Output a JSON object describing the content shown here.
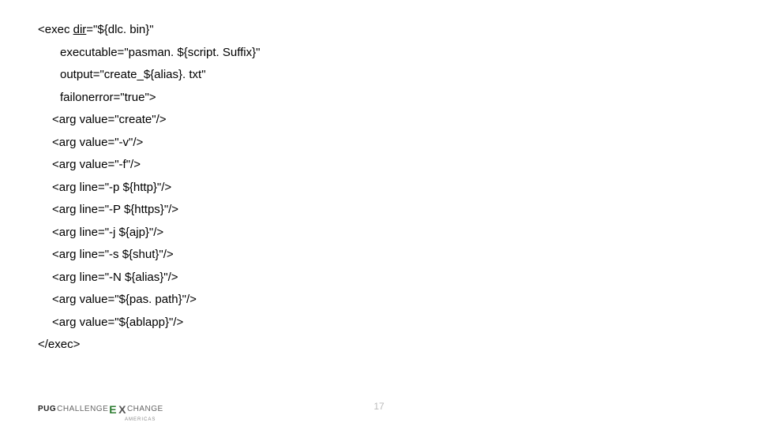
{
  "code": {
    "lines": [
      {
        "indent": "l0",
        "html": "<exec <span class=\"underline\">dir</span>=\"${dlc. bin}\""
      },
      {
        "indent": "l1",
        "text": "executable=\"pasman. ${script. Suffix}\""
      },
      {
        "indent": "l1",
        "text": "output=\"create_${alias}. txt\""
      },
      {
        "indent": "l1",
        "text": "failonerror=\"true\">"
      },
      {
        "indent": "l2",
        "text": "<arg value=\"create\"/>"
      },
      {
        "indent": "l2",
        "text": "<arg value=\"-v\"/>"
      },
      {
        "indent": "l2",
        "text": "<arg value=\"-f\"/>"
      },
      {
        "indent": "l2",
        "text": "<arg line=\"-p ${http}\"/>"
      },
      {
        "indent": "l2",
        "text": "<arg line=\"-P ${https}\"/>"
      },
      {
        "indent": "l2",
        "text": "<arg line=\"-j ${ajp}\"/>"
      },
      {
        "indent": "l2",
        "text": "<arg line=\"-s ${shut}\"/>"
      },
      {
        "indent": "l2",
        "text": "<arg line=\"-N ${alias}\"/>"
      },
      {
        "indent": "l2",
        "text": "<arg value=\"${pas. path}\"/>"
      },
      {
        "indent": "l2",
        "text": "<arg value=\"${ablapp}\"/>"
      },
      {
        "indent": "l0",
        "text": "</exec>"
      }
    ]
  },
  "footer": {
    "logo_pug": "PUG",
    "logo_chal": "CHALLENGE",
    "logo_e": "E",
    "logo_x": "X",
    "logo_change": "CHANGE",
    "logo_sub": "AMERICAS",
    "page": "17"
  }
}
